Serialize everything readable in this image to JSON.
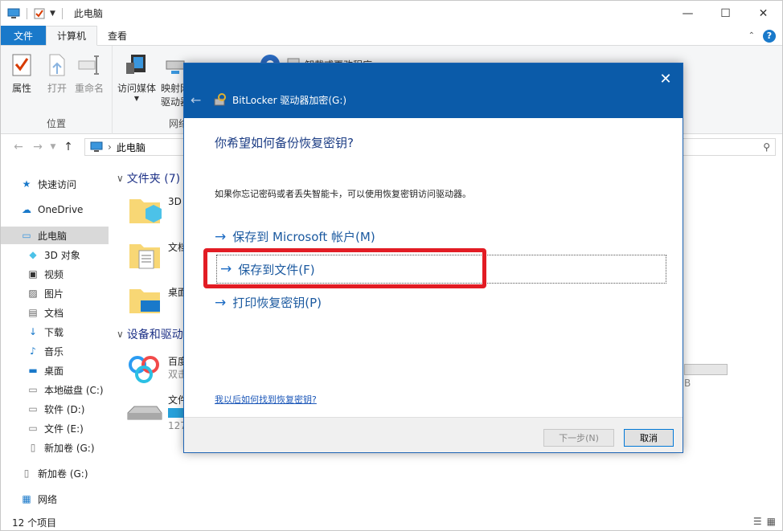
{
  "titlebar": {
    "title": "此电脑"
  },
  "ribbon": {
    "tabs": [
      "文件",
      "计算机",
      "查看"
    ],
    "groups": {
      "location": "位置",
      "network": "网络"
    },
    "buttons": {
      "properties": "属性",
      "open": "打开",
      "rename": "重命名",
      "access_media": "访问媒体",
      "map_drive_l1": "映射网",
      "map_drive_l2": "驱动器",
      "uninstall": "卸载或更改程序"
    }
  },
  "address": {
    "path": "此电脑"
  },
  "navpane": {
    "items": [
      {
        "label": "快速访问",
        "icon": "star-icon"
      },
      {
        "label": "OneDrive",
        "icon": "cloud-icon"
      },
      {
        "label": "此电脑",
        "icon": "computer-icon"
      },
      {
        "label": "3D 对象",
        "icon": "cube-icon"
      },
      {
        "label": "视频",
        "icon": "video-icon"
      },
      {
        "label": "图片",
        "icon": "picture-icon"
      },
      {
        "label": "文档",
        "icon": "document-icon"
      },
      {
        "label": "下载",
        "icon": "download-icon"
      },
      {
        "label": "音乐",
        "icon": "music-icon"
      },
      {
        "label": "桌面",
        "icon": "desktop-icon"
      },
      {
        "label": "本地磁盘 (C:)",
        "icon": "drive-icon"
      },
      {
        "label": "软件 (D:)",
        "icon": "drive-icon"
      },
      {
        "label": "文件 (E:)",
        "icon": "drive-icon"
      },
      {
        "label": "新加卷 (G:)",
        "icon": "usb-drive-icon"
      },
      {
        "label": "新加卷 (G:)",
        "icon": "usb-drive-icon"
      },
      {
        "label": "网络",
        "icon": "network-icon"
      }
    ]
  },
  "content": {
    "folders_header": "文件夹 (7)",
    "devices_header": "设备和驱动",
    "folders": [
      {
        "label": "3D"
      },
      {
        "label": "文档"
      },
      {
        "label": "桌面"
      }
    ],
    "devices": [
      {
        "name": "百度",
        "sub": "双击"
      },
      {
        "name": "文件",
        "sub": "127"
      }
    ],
    "side_number": "B",
    "drive_usage": 0.8
  },
  "statusbar": {
    "count": "12 个项目"
  },
  "dialog": {
    "title": "BitLocker 驱动器加密(G:)",
    "heading": "你希望如何备份恢复密钥?",
    "description": "如果你忘记密码或者丢失智能卡，可以使用恢复密钥访问驱动器。",
    "options": [
      "保存到 Microsoft 帐户(M)",
      "保存到文件(F)",
      "打印恢复密钥(P)"
    ],
    "help_link": "我以后如何找到恢复密钥?",
    "next_button": "下一步(N)",
    "cancel_button": "取消"
  },
  "colors": {
    "accent": "#1979ca",
    "dialog_header": "#0b5ba9",
    "highlight_box": "#e21c24",
    "option_text": "#1c5aa0"
  }
}
